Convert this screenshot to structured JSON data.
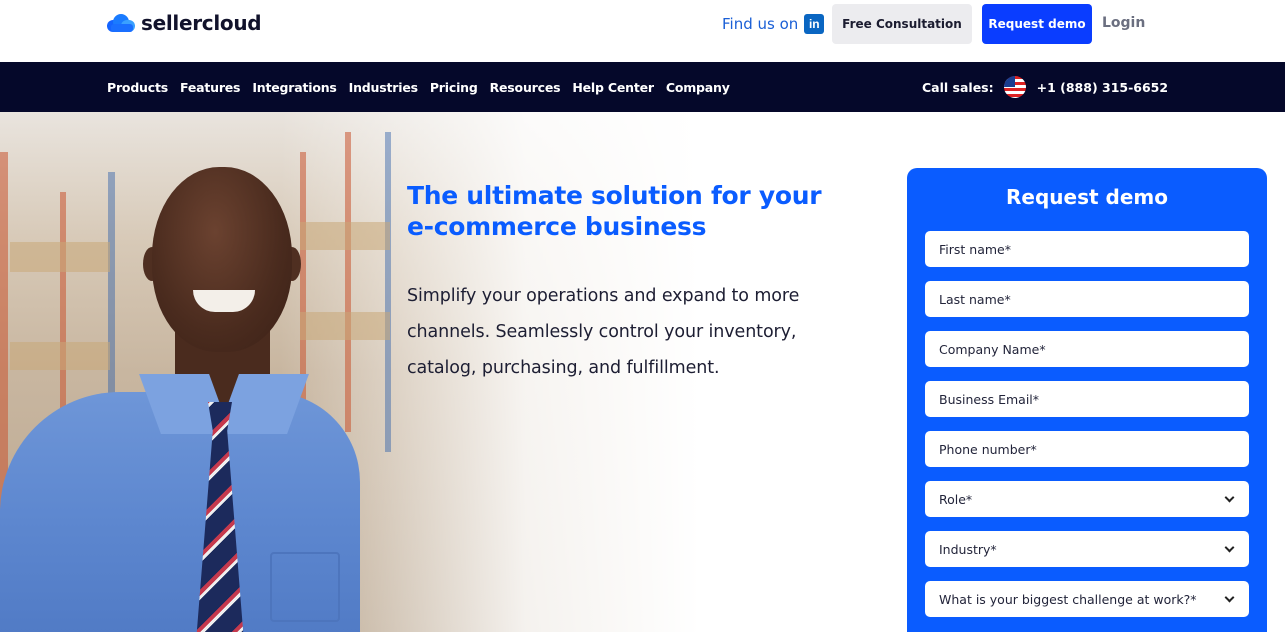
{
  "header": {
    "logo_text": "sellercloud",
    "find_us_label": "Find us on",
    "linkedin_icon": "linkedin-icon",
    "free_consultation": "Free Consultation",
    "request_demo": "Request demo",
    "login": "Login"
  },
  "nav": {
    "items": [
      "Products",
      "Features",
      "Integrations",
      "Industries",
      "Pricing",
      "Resources",
      "Help Center",
      "Company"
    ],
    "call_sales_label": "Call sales:",
    "flag_icon": "us-flag-icon",
    "phone": "+1 (888) 315-6652"
  },
  "hero": {
    "title": "The ultimate solution for your e-commerce business",
    "subtitle": "Simplify your operations and expand to more channels. Seamlessly control your inventory, catalog, purchasing, and fulfillment."
  },
  "form": {
    "title": "Request demo",
    "fields": [
      {
        "label": "First name*",
        "type": "text"
      },
      {
        "label": "Last name*",
        "type": "text"
      },
      {
        "label": "Company Name*",
        "type": "text"
      },
      {
        "label": "Business Email*",
        "type": "text"
      },
      {
        "label": "Phone number*",
        "type": "text"
      },
      {
        "label": "Role*",
        "type": "select"
      },
      {
        "label": "Industry*",
        "type": "select"
      },
      {
        "label": "What is your biggest challenge at work?*",
        "type": "select"
      }
    ]
  },
  "colors": {
    "brand_blue": "#0a5cff",
    "nav_bg": "#05082a",
    "demo_button": "#0a3dff"
  }
}
